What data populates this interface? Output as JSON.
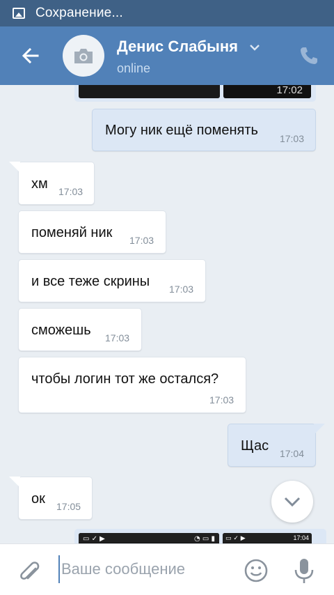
{
  "status_bar": {
    "text": "Сохранение...",
    "icon": "image-icon"
  },
  "header": {
    "contact_name": "Денис Слабыня",
    "contact_status": "online",
    "icons": {
      "back": "arrow-left-icon",
      "avatar": "camera-icon",
      "name_menu": "chevron-down-icon",
      "call": "phone-icon"
    }
  },
  "messages": [
    {
      "direction": "out",
      "text": "Могу ник ещё поменять",
      "time": "17:03"
    },
    {
      "direction": "in",
      "text": "хм",
      "time": "17:03"
    },
    {
      "direction": "in",
      "text": "поменяй ник",
      "time": "17:03"
    },
    {
      "direction": "in",
      "text": "и все теже скрины",
      "time": "17:03"
    },
    {
      "direction": "in",
      "text": "сможешь",
      "time": "17:03"
    },
    {
      "direction": "in",
      "text": "чтобы логин тот же остался?",
      "time": "17:03"
    },
    {
      "direction": "out",
      "text": "Щас",
      "time": "17:04"
    },
    {
      "direction": "in",
      "text": "ок",
      "time": "17:05"
    }
  ],
  "attachments": {
    "top_thumb_time": "17:02",
    "bottom_thumb_time": "17:04"
  },
  "composer": {
    "placeholder": "Ваше сообщение",
    "value": ""
  },
  "colors": {
    "header": "#5181b8",
    "status_bar": "#3f6186",
    "background": "#e9eef3",
    "outgoing_bubble": "#dce7f5",
    "incoming_bubble": "#ffffff"
  }
}
